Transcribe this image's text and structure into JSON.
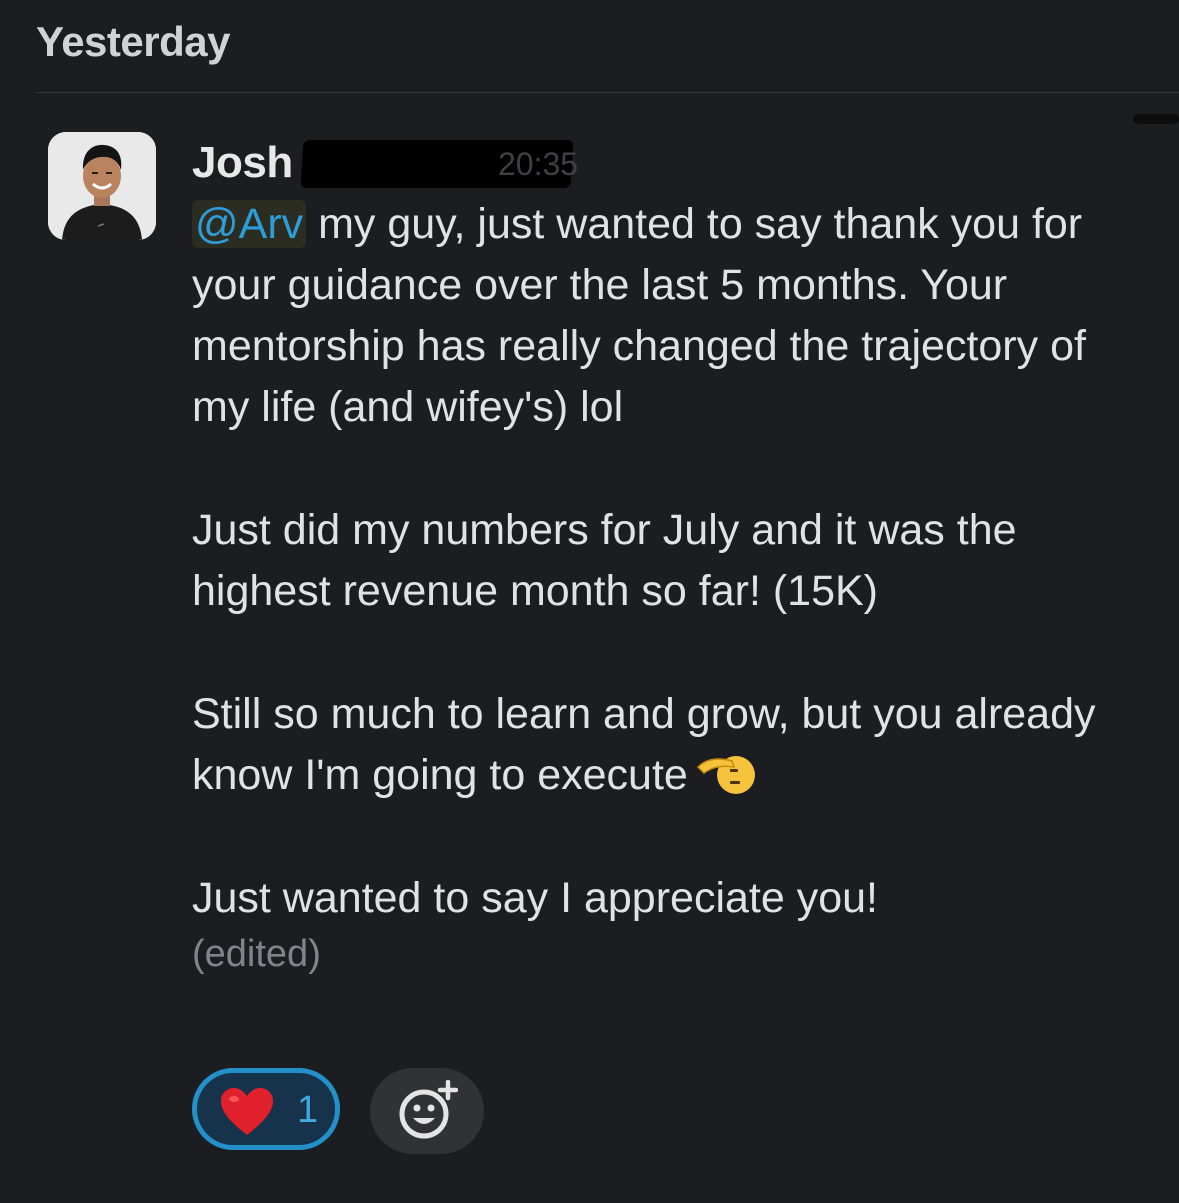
{
  "day_header": "Yesterday",
  "message": {
    "author": "Josh",
    "timestamp": "20:35",
    "mention": "@Arv",
    "paragraph1": " my guy, just wanted to say thank you for your guidance over the last 5 months. Your mentorship has really changed the trajectory of my life (and wifey's) lol",
    "paragraph2": "Just did my numbers for July and it was the highest revenue month so far! (15K)",
    "paragraph3": "Still so much to learn and grow, but you already know I'm going to execute",
    "paragraph3_emoji": "saluting-face-icon",
    "paragraph4": "Just wanted to say I appreciate you!",
    "edited_label": "(edited)"
  },
  "reactions": [
    {
      "emoji": "heart-icon",
      "count": "1",
      "selected": true
    }
  ],
  "add_reaction_icon": "add-reaction-icon",
  "colors": {
    "background": "#1b1d21",
    "mention": "#2d9dd8",
    "reaction_border": "#2390c9",
    "muted": "#81848a"
  }
}
